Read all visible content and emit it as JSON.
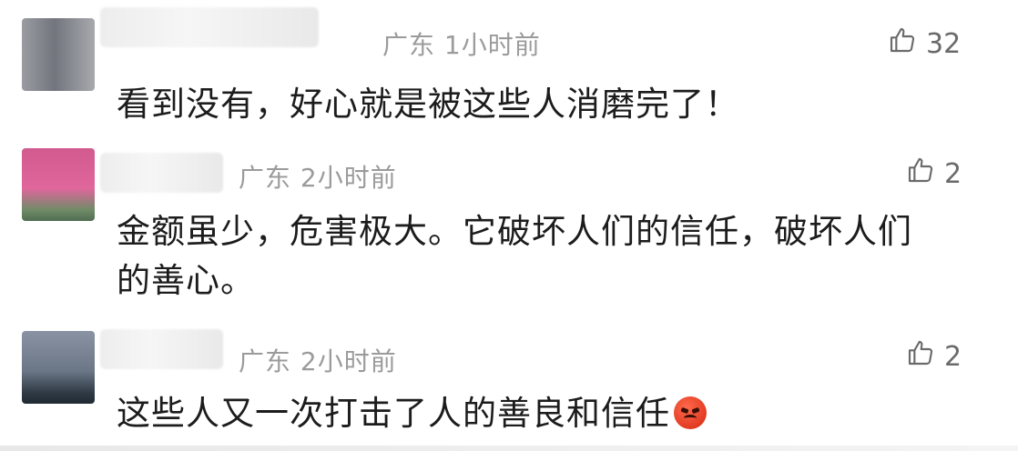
{
  "comments": [
    {
      "location": "广东",
      "time": "1小时前",
      "likes": "32",
      "text_lines": [
        "看到没有，好心就是被这些人消磨完了！"
      ],
      "like_icon": "thumbs-up-icon"
    },
    {
      "location": "广东",
      "time": "2小时前",
      "likes": "2",
      "text_lines": [
        "金额虽少，危害极大。它破坏人们的信任，破坏人们",
        "的善心。"
      ],
      "like_icon": "thumbs-up-icon"
    },
    {
      "location": "广东",
      "time": "2小时前",
      "likes": "2",
      "text_lines": [
        "这些人又一次打击了人的善良和信任"
      ],
      "like_icon": "thumbs-up-icon",
      "emoji": "angry-face-emoji"
    }
  ]
}
